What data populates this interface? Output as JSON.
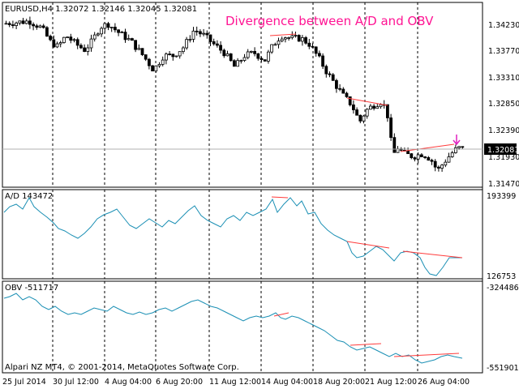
{
  "header": {
    "symbol_info": "EURUSD,H4  1.32072 1.32146 1.32045 1.32081",
    "title": "Divergence between A/D and OBV"
  },
  "main_pane": {
    "price_ticks": [
      "1.34230",
      "1.33770",
      "1.33310",
      "1.32850",
      "1.32390",
      "1.31930",
      "1.31470"
    ],
    "current_price": "1.32081",
    "ylim": [
      1.3147,
      1.3446
    ],
    "arrow_icon": "down-arrow-icon"
  },
  "ad_pane": {
    "label": "A/D 143472",
    "scale_top": "193399",
    "scale_bottom": "126753"
  },
  "obv_pane": {
    "label": "OBV -511717",
    "scale_top": "-324486",
    "scale_bottom": "-551901"
  },
  "footer": {
    "copyright": "Alpari NZ MT4, © 2001-2014, MetaQuotes Software Corp.",
    "dates": [
      "25 Jul 2014",
      "30 Jul 12:00",
      "4 Aug 04:00",
      "6 Aug 20:00",
      "11 Aug 12:00",
      "14 Aug 04:00",
      "18 Aug 20:00",
      "21 Aug 12:00",
      "26 Aug 04:00"
    ]
  },
  "colors": {
    "up_candle": "#ffffff",
    "down_candle": "#000000",
    "indicator_line": "#1a8fb4",
    "divergence_line": "#ff3b3b",
    "title": "#ff1493",
    "arrow": "#e020c0"
  },
  "chart_data": {
    "type": "line",
    "x": [
      "25 Jul 2014",
      "30 Jul 12:00",
      "4 Aug 04:00",
      "6 Aug 20:00",
      "11 Aug 12:00",
      "14 Aug 04:00",
      "18 Aug 20:00",
      "21 Aug 12:00",
      "26 Aug 04:00"
    ],
    "series": [
      {
        "name": "EURUSD,H4",
        "values": [
          1.343,
          1.34,
          1.339,
          1.3385,
          1.3385,
          1.3395,
          1.334,
          1.323,
          1.3185
        ]
      },
      {
        "name": "A/D",
        "values": [
          183000,
          177000,
          178000,
          180000,
          178000,
          184000,
          160000,
          152000,
          150000
        ]
      },
      {
        "name": "OBV",
        "values": [
          -340000,
          -375000,
          -380000,
          -370000,
          -372000,
          -365000,
          -425000,
          -525000,
          -527000
        ]
      }
    ]
  }
}
